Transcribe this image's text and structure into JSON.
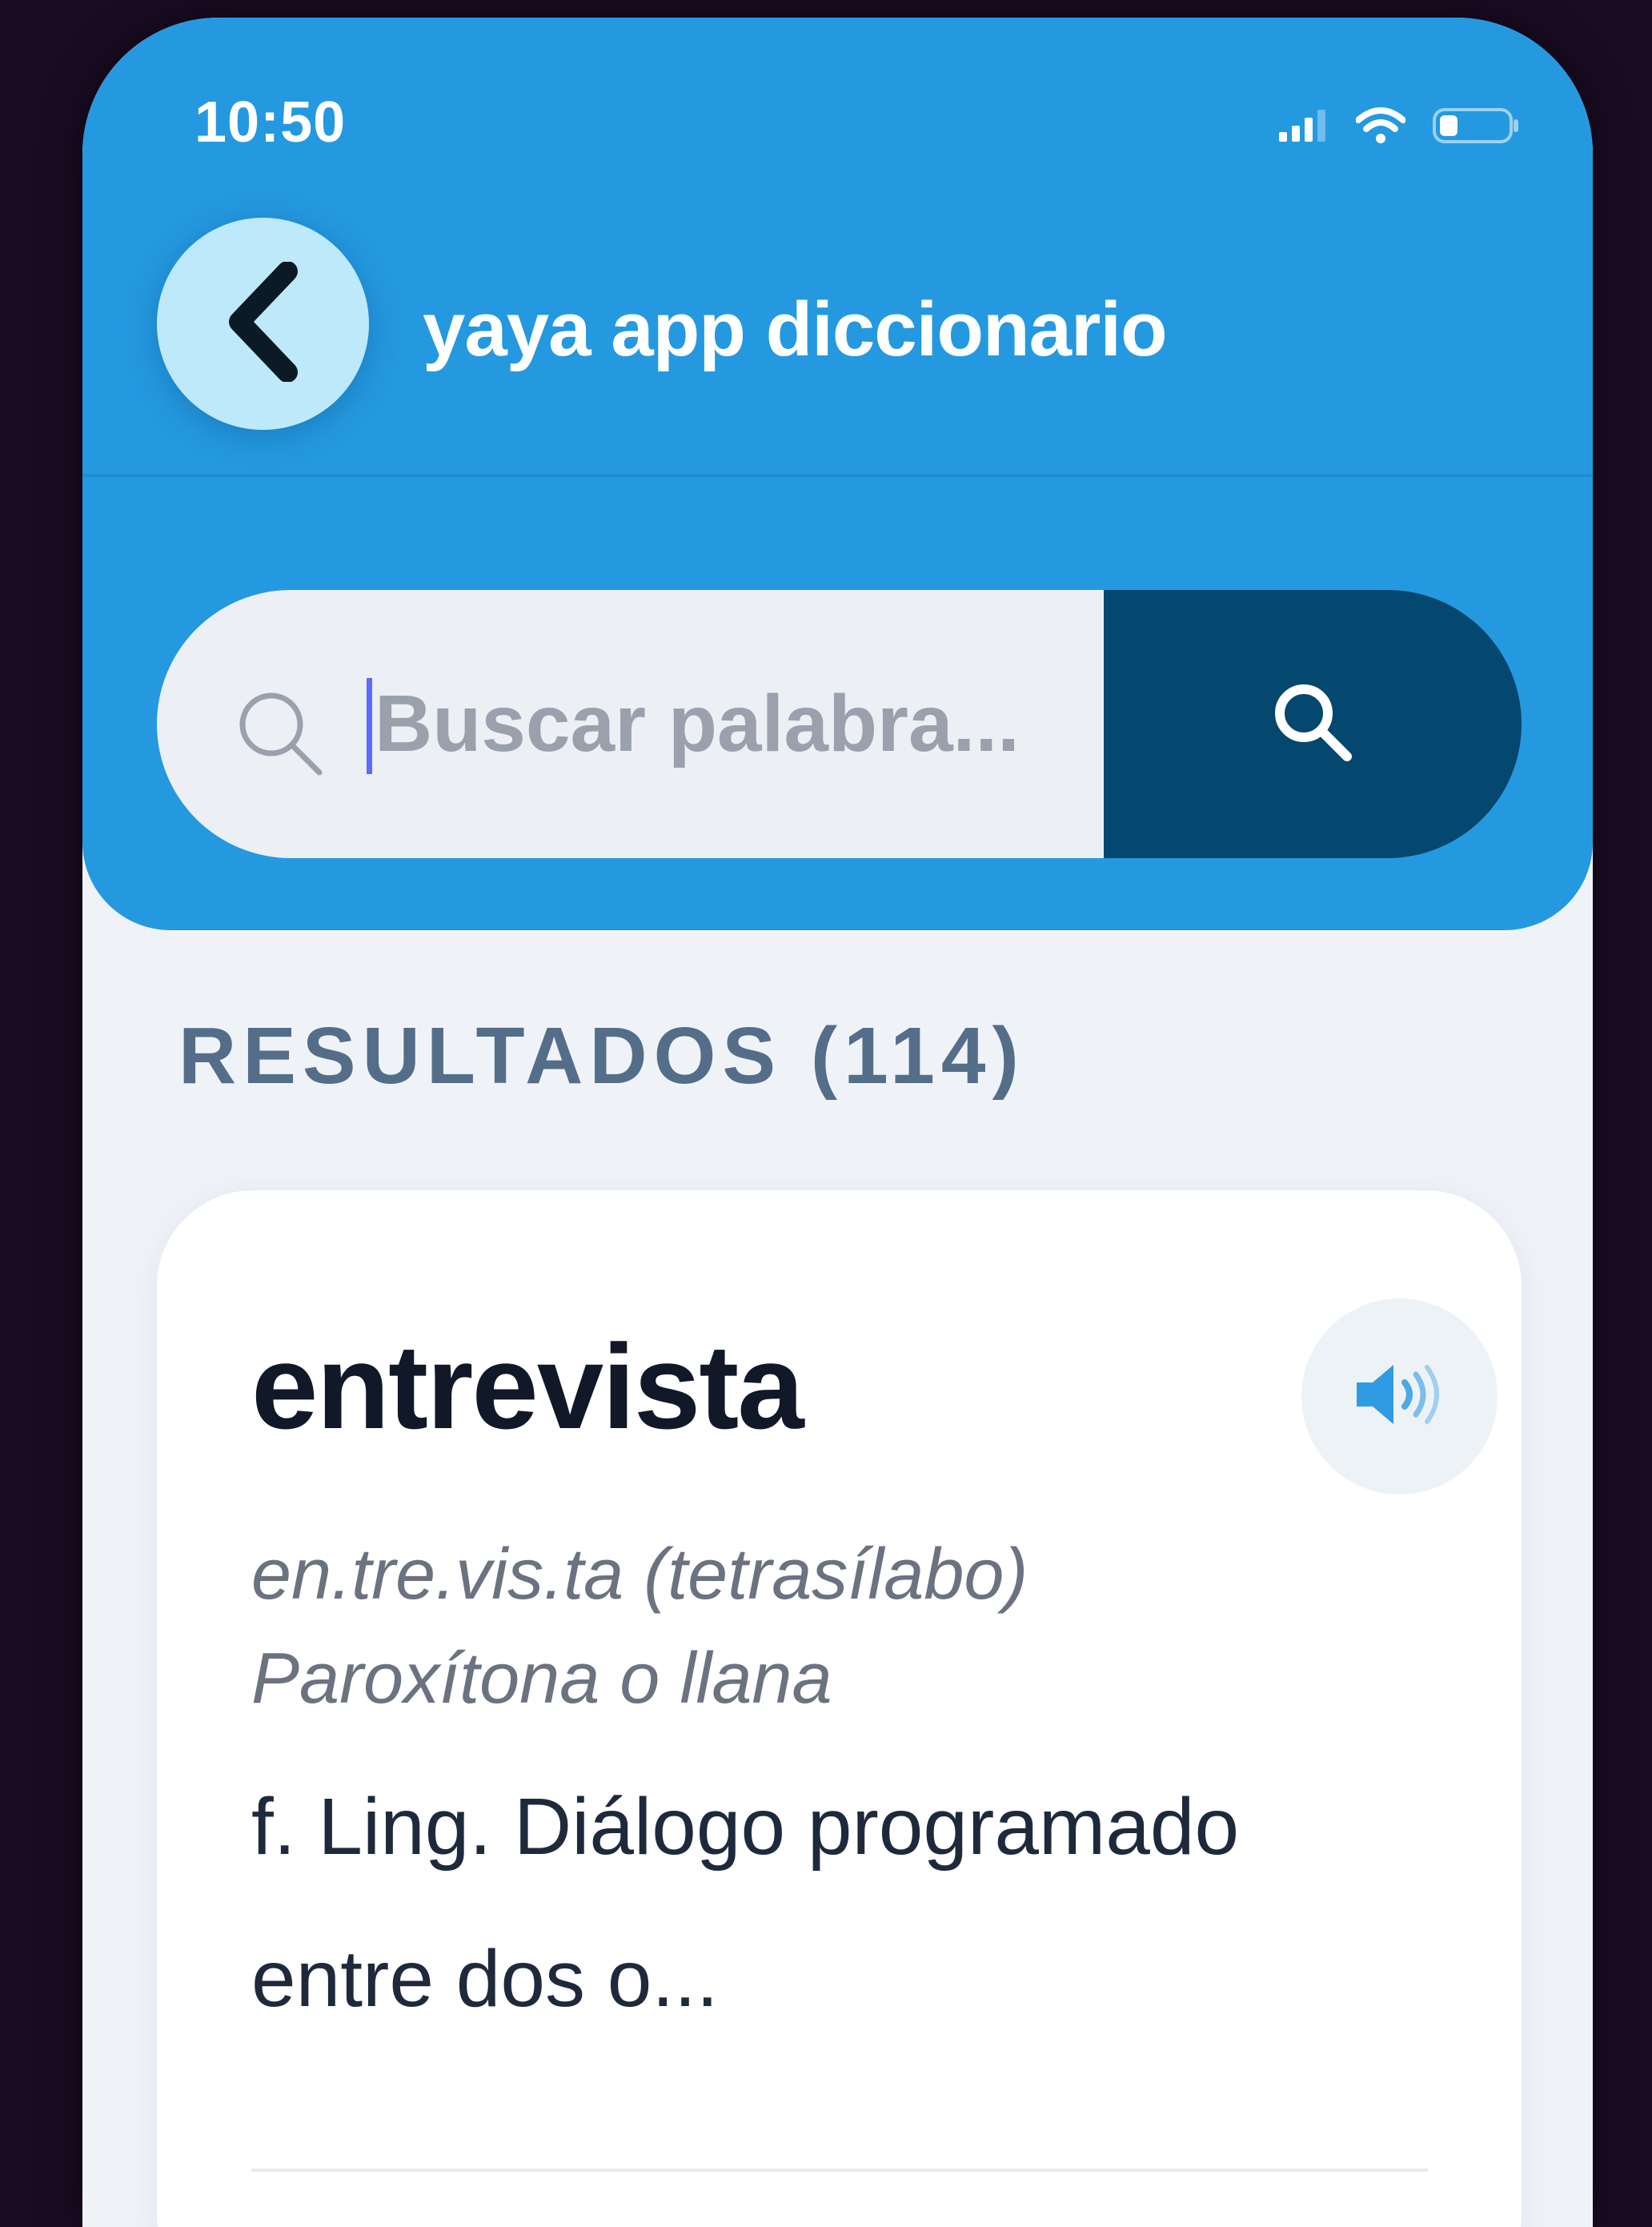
{
  "status_bar": {
    "time": "10:50",
    "icons": [
      "signal-icon",
      "wifi-icon",
      "battery-icon"
    ]
  },
  "nav": {
    "back_icon": "chevron-left-icon",
    "title": "yaya app diccionario"
  },
  "search": {
    "value": "",
    "placeholder": "Buscar palabra...",
    "leading_icon": "search-icon",
    "button_icon": "search-icon"
  },
  "results": {
    "label": "RESULTADOS (114)",
    "items": [
      {
        "word": "entrevista",
        "syllables": "en.tre.vis.ta (tetrasílabo)",
        "stress": "Paroxítona o llana",
        "definition": "f. Ling. Diálogo programado entre dos o...",
        "audio_icon": "speaker-icon"
      }
    ]
  },
  "colors": {
    "header": "#2499e0",
    "search_button": "#04476f",
    "back_button": "#bde9fb",
    "background": "#eff3f8",
    "results_label": "#546e8a",
    "word": "#111827",
    "audio_icon": "#2f9be3"
  }
}
